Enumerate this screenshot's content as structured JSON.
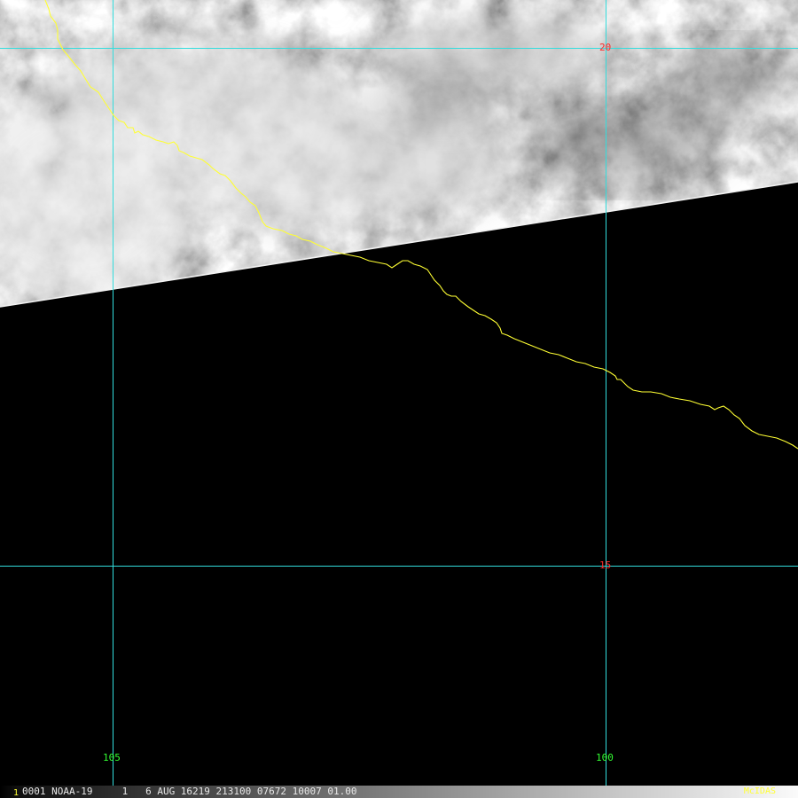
{
  "image": {
    "satellite": "NOAA-19",
    "grid_line_color": "#33dddd",
    "coastline_color": "#ffff33",
    "latitude_label_color": "#ff2a2a",
    "longitude_label_color": "#33ff33",
    "no_data_color": "#000000"
  },
  "grid": {
    "latitudes": [
      "20",
      "15"
    ],
    "longitudes": [
      "105",
      "100"
    ]
  },
  "status_bar": {
    "frame_number": "1",
    "text": "0001 NOAA-19     1   6 AUG 16219 213100 07672 10007 01.00",
    "brand": "McIDAS"
  }
}
